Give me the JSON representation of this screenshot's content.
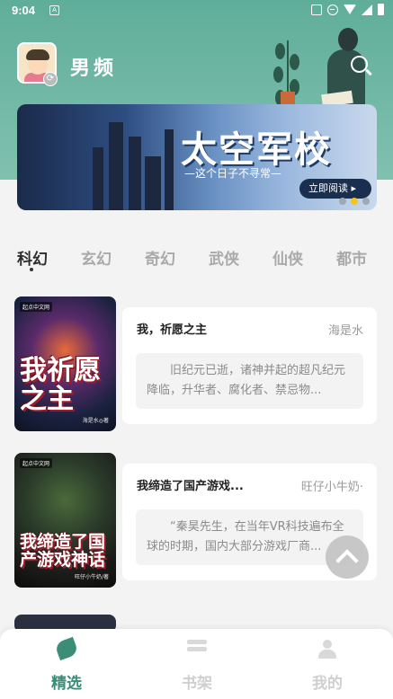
{
  "status_bar": {
    "time": "9:04"
  },
  "header": {
    "channel_title": "男频",
    "colors": {
      "accent": "#3b8d77",
      "header_bg": "#6fb5a2"
    }
  },
  "banner": {
    "title": "太空军校",
    "subtitle": "—这个日子不寻常—",
    "cta": "立即阅读 ▸",
    "active_dot_index": 1,
    "dot_count": 3
  },
  "categories": [
    {
      "label": "科幻",
      "active": true
    },
    {
      "label": "玄幻",
      "active": false
    },
    {
      "label": "奇幻",
      "active": false
    },
    {
      "label": "武侠",
      "active": false
    },
    {
      "label": "仙侠",
      "active": false
    },
    {
      "label": "都市",
      "active": false
    }
  ],
  "books": [
    {
      "title": "我，祈愿之主",
      "author": "海是水",
      "description": "旧纪元已逝，诸神并起的超凡纪元降临，升华者、腐化者、禁忌物...",
      "cover_title": "我祈愿之主",
      "cover_badge": "起点中文网",
      "cover_author": "海是水◎著"
    },
    {
      "title": "我缔造了国产游戏...",
      "author": "旺仔小牛奶·",
      "description": "“秦昊先生，在当年VR科技遍布全球的时期，国内大部分游戏厂商...",
      "cover_title": "我缔造了国产游戏神话",
      "cover_badge": "起点中文网",
      "cover_author": "旺仔小牛奶/著"
    }
  ],
  "bottom_nav": [
    {
      "label": "精选",
      "icon": "leaf-icon",
      "active": true
    },
    {
      "label": "书架",
      "icon": "bookshelf-icon",
      "active": false
    },
    {
      "label": "我的",
      "icon": "user-icon",
      "active": false
    }
  ]
}
